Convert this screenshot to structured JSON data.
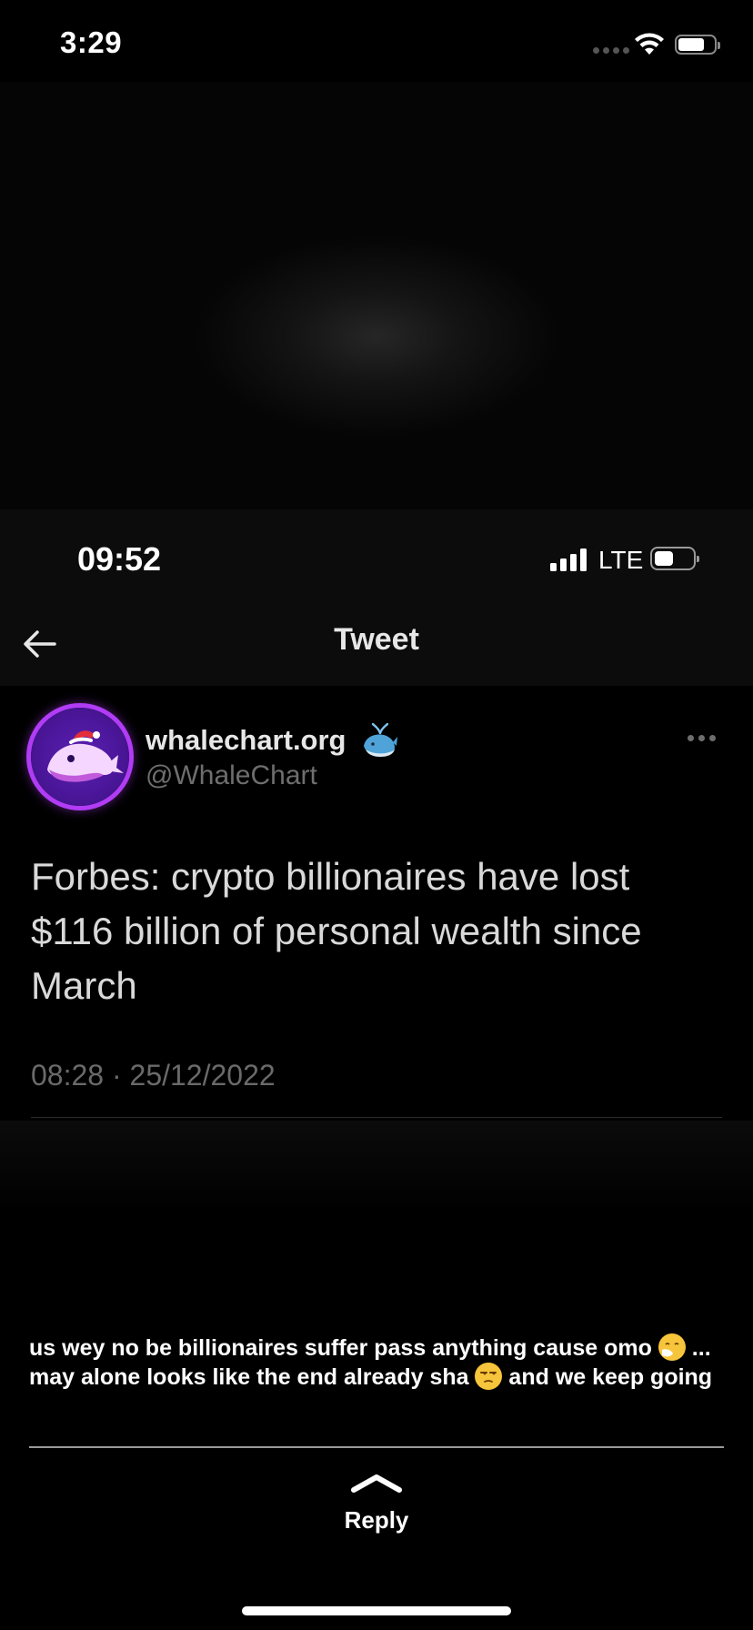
{
  "outer_status": {
    "time": "3:29"
  },
  "inner_status": {
    "time": "09:52",
    "network": "LTE"
  },
  "nav": {
    "title": "Tweet"
  },
  "tweet": {
    "display_name": "whalechart.org",
    "handle": "@WhaleChart",
    "text": "Forbes: crypto billionaires have lost $116 billion of personal wealth since March",
    "timestamp": "08:28 · 25/12/2022"
  },
  "caption": {
    "part1": "us wey no be billionaires suffer pass anything cause omo ",
    "part2": " ... may alone looks like the end already sha ",
    "part3": " and we keep going"
  },
  "reply": {
    "label": "Reply"
  },
  "colors": {
    "avatar_ring": "#b13cf5",
    "muted_text": "#6e6e6e"
  }
}
